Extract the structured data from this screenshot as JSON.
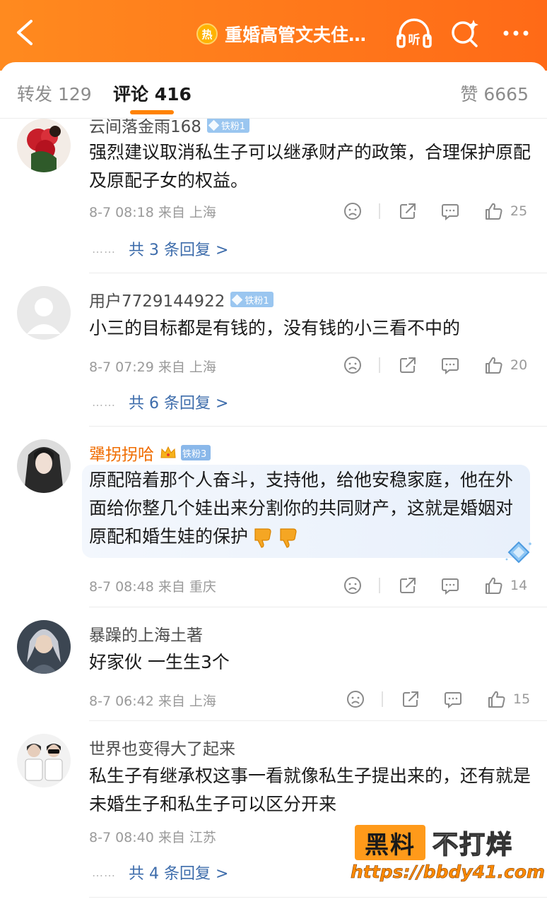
{
  "header": {
    "hot_badge": "热",
    "title": "重婚高管文夫住…",
    "listen_label": "听"
  },
  "tabs": {
    "repost": "转发 129",
    "comment": "评论 416",
    "like": "赞 6665"
  },
  "comments": [
    {
      "username": "云间落金雨168",
      "fan_badge": "铁粉1",
      "text": "强烈建议取消私生子可以继承财产的政策，合理保护原配及原配子女的权益。",
      "meta": "8-7 08:18  来自 上海",
      "likes": "25",
      "replies": "共 3 条回复 >"
    },
    {
      "username": "用户7729144922",
      "fan_badge": "铁粉1",
      "text": "小三的目标都是有钱的，没有钱的小三看不中的",
      "meta": "8-7 07:29  来自 上海",
      "likes": "20",
      "replies": "共 6 条回复 >"
    },
    {
      "username": "犟拐拐哈",
      "fan_badge": "铁粉3",
      "text": "原配陪着那个人奋斗，支持他，给他安稳家庭，他在外面给你整几个娃出来分割你的共同财产，这就是婚姻对原配和婚生娃的保护",
      "meta": "8-7 08:48  来自 重庆",
      "likes": "14"
    },
    {
      "username": "暴躁的上海土著",
      "text": "好家伙 一生生3个",
      "meta": "8-7 06:42  来自 上海",
      "likes": "15"
    },
    {
      "username": "世界也变得大了起来",
      "text": "私生子有继承权这事一看就像私生子提出来的，还有就是未婚生子和私生子可以区分开来",
      "meta": "8-7 08:40  来自 江苏",
      "replies": "共 4 条回复 >"
    }
  ],
  "watermark": {
    "box_text": "黑料",
    "rest_text": "不打烊",
    "url": "https://bbdy41.com"
  },
  "colors": {
    "header_bg": "#ff7a1a",
    "accent": "#ff8200",
    "reply_link": "#3d6cab",
    "orange_username": "#f06c00"
  }
}
